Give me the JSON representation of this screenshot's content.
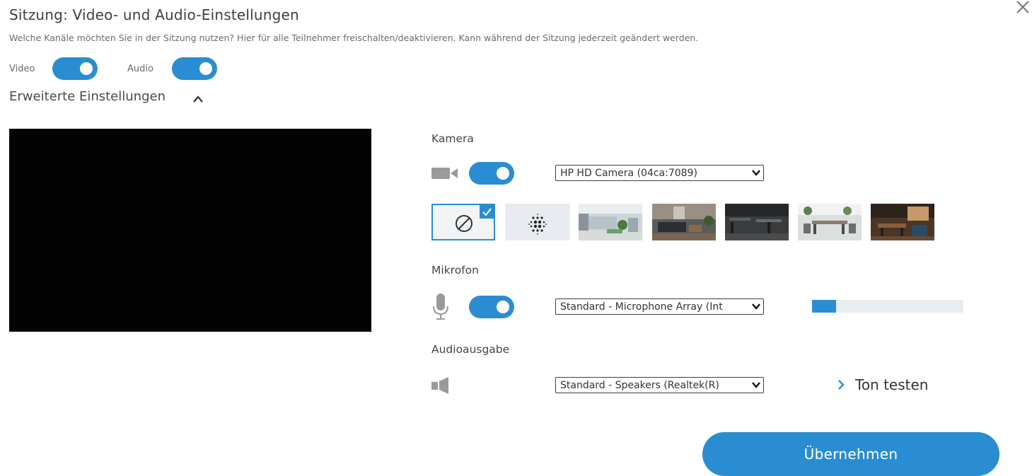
{
  "dialog": {
    "title": "Sitzung: Video- und Audio-Einstellungen",
    "subtitle": "Welche Kanäle möchten Sie in der Sitzung nutzen? Hier für alle Teilnehmer freischalten/deaktivieren. Kann während der Sitzung jederzeit geändert werden.",
    "close_icon": "close-icon"
  },
  "channels": {
    "video_label": "Video",
    "video_enabled": true,
    "audio_label": "Audio",
    "audio_enabled": true
  },
  "advanced": {
    "label": "Erweiterte Einstellungen",
    "expanded": true
  },
  "camera": {
    "label": "Kamera",
    "icon": "video-camera-icon",
    "enabled": true,
    "selected_device": "HP HD Camera (04ca:7089)"
  },
  "backgrounds": {
    "selected": "none",
    "items": [
      "none",
      "blur",
      "office-1",
      "office-2",
      "office-3",
      "office-4",
      "office-5"
    ]
  },
  "microphone": {
    "label": "Mikrofon",
    "icon": "microphone-icon",
    "enabled": true,
    "selected_device": "Standard - Microphone Array (Int",
    "level_percent": 16
  },
  "audio_output": {
    "label": "Audioausgabe",
    "icon": "speaker-icon",
    "selected_device": "Standard - Speakers (Realtek(R)",
    "test_label": "Ton testen"
  },
  "actions": {
    "apply_label": "Übernehmen"
  },
  "colors": {
    "accent": "#2b8dd1",
    "preview_bg": "#030303"
  }
}
